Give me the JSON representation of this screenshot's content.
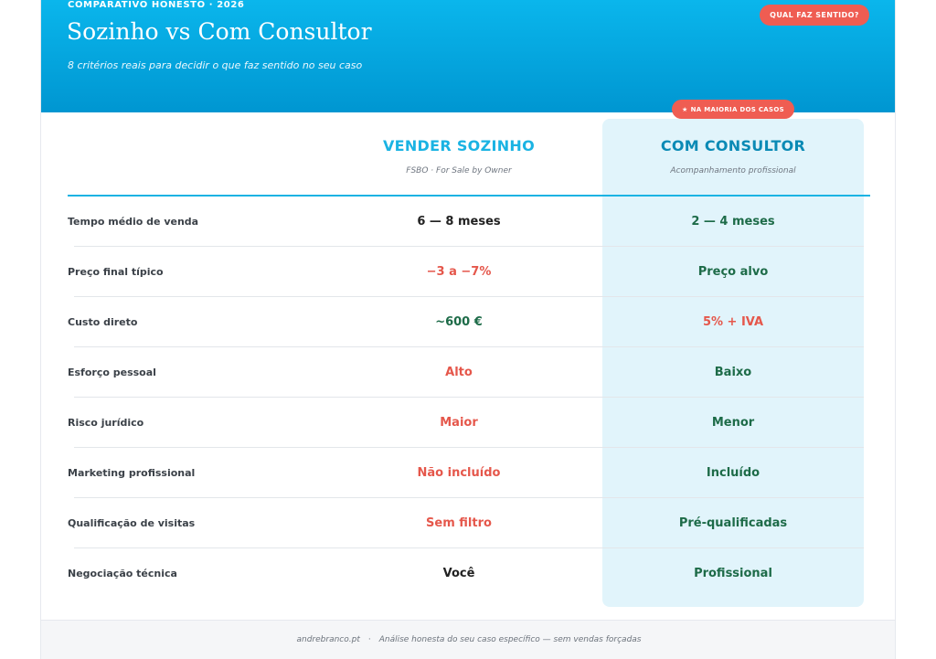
{
  "header": {
    "eyebrow": "COMPARATIVO HONESTO · 2026",
    "title": "Sozinho vs Com Consultor",
    "subtitle": "8 critérios reais para decidir o que faz sentido no seu caso",
    "badge": "QUAL FAZ SENTIDO?"
  },
  "recommended_badge": {
    "icon": "star-icon",
    "star": "★",
    "label": "NA MAIORIA DOS CASOS"
  },
  "columns": {
    "solo": {
      "title": "VENDER SOZINHO",
      "subtitle": "FSBO · For Sale by Owner"
    },
    "consultant": {
      "title": "COM CONSULTOR",
      "subtitle": "Acompanhamento profissional"
    }
  },
  "rows": [
    {
      "label": "Tempo médio de venda",
      "solo": "6 — 8 meses",
      "solo_tone": "neutral",
      "consultant": "2 — 4 meses",
      "consultant_tone": "good"
    },
    {
      "label": "Preço final típico",
      "solo": "−3 a −7%",
      "solo_tone": "bad",
      "consultant": "Preço alvo",
      "consultant_tone": "good"
    },
    {
      "label": "Custo direto",
      "solo": "~600 €",
      "solo_tone": "good",
      "consultant": "5% + IVA",
      "consultant_tone": "bad"
    },
    {
      "label": "Esforço pessoal",
      "solo": "Alto",
      "solo_tone": "bad",
      "consultant": "Baixo",
      "consultant_tone": "good"
    },
    {
      "label": "Risco jurídico",
      "solo": "Maior",
      "solo_tone": "bad",
      "consultant": "Menor",
      "consultant_tone": "good"
    },
    {
      "label": "Marketing profissional",
      "solo": "Não incluído",
      "solo_tone": "bad",
      "consultant": "Incluído",
      "consultant_tone": "good"
    },
    {
      "label": "Qualificação de visitas",
      "solo": "Sem filtro",
      "solo_tone": "bad",
      "consultant": "Pré-qualificadas",
      "consultant_tone": "good"
    },
    {
      "label": "Negociação técnica",
      "solo": "Você",
      "solo_tone": "neutral",
      "consultant": "Profissional",
      "consultant_tone": "good"
    }
  ],
  "footer": {
    "site": "andrebranco.pt",
    "separator": "·",
    "note": "Análise honesta do seu caso específico — sem vendas forçadas"
  },
  "colors": {
    "header_gradient_top": "#0ab6ec",
    "header_gradient_bottom": "#0096d1",
    "accent": "#1ab3e3",
    "badge": "#ef5d52",
    "good": "#1d6b48",
    "bad": "#e5574b",
    "highlight": "#e1f4fb"
  }
}
